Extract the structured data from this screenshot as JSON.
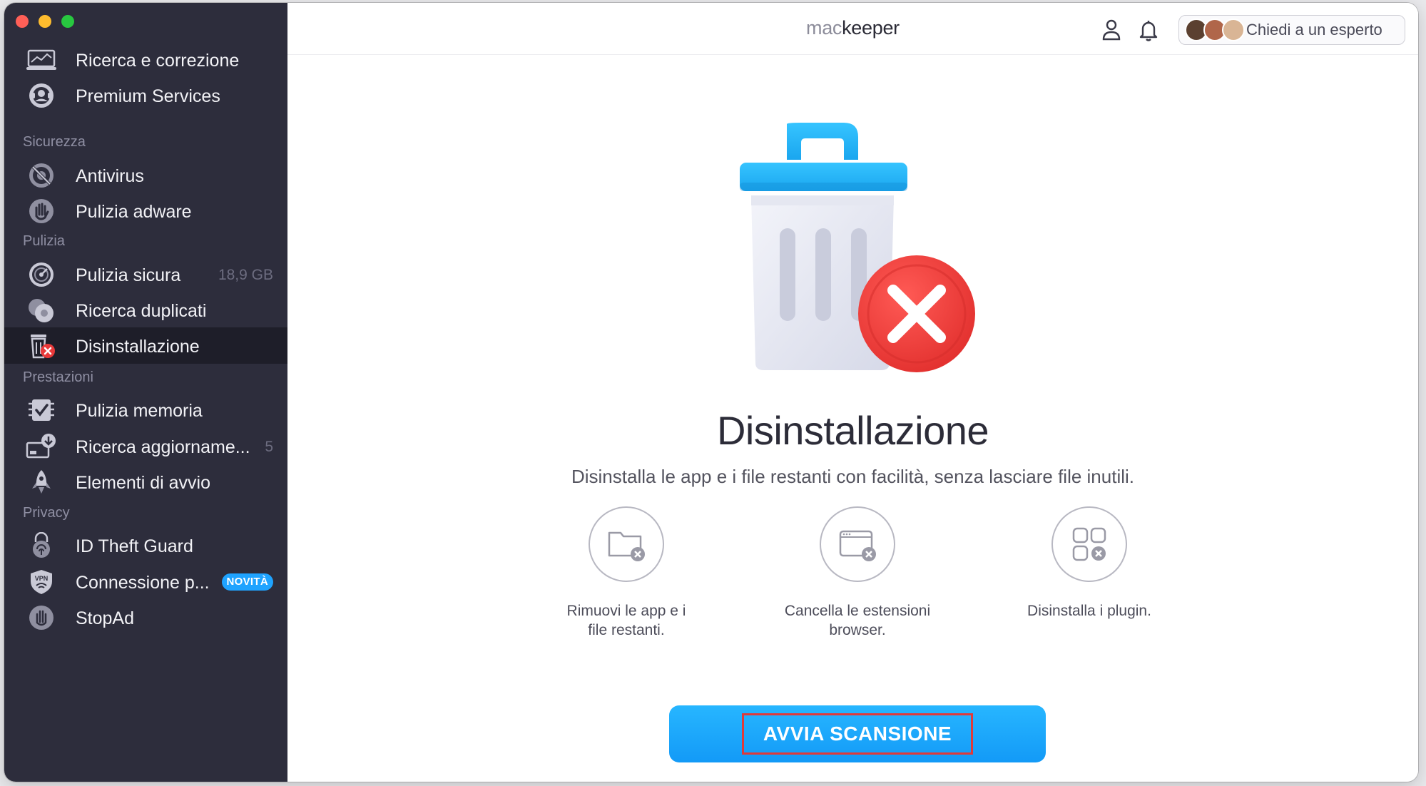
{
  "window": {
    "traffic_lights": [
      "close",
      "minimize",
      "maximize"
    ]
  },
  "sidebar": {
    "items": [
      {
        "label": "Ricerca e correzione",
        "icon": "laptop-chart-icon"
      },
      {
        "label": "Premium Services",
        "icon": "support-agent-icon"
      },
      {
        "label": "Antivirus",
        "icon": "antivirus-icon",
        "section": "Sicurezza"
      },
      {
        "label": "Pulizia adware",
        "icon": "hand-stop-icon"
      },
      {
        "label": "Pulizia sicura",
        "icon": "disk-cleaner-icon",
        "section": "Pulizia",
        "count": "18,9 GB"
      },
      {
        "label": "Ricerca duplicati",
        "icon": "duplicates-icon"
      },
      {
        "label": "Disinstallazione",
        "icon": "trash-uninstall-icon",
        "active": true
      },
      {
        "label": "Pulizia memoria",
        "icon": "memory-chip-icon",
        "section": "Prestazioni"
      },
      {
        "label": "Ricerca aggiorname...",
        "icon": "update-download-icon",
        "count": "5"
      },
      {
        "label": "Elementi di avvio",
        "icon": "rocket-icon"
      },
      {
        "label": "ID Theft Guard",
        "icon": "fingerprint-lock-icon",
        "section": "Privacy"
      },
      {
        "label": "Connessione p...",
        "icon": "vpn-shield-icon",
        "badge": "NOVITÀ"
      },
      {
        "label": "StopAd",
        "icon": "stopad-hand-icon"
      }
    ],
    "sections": [
      "Sicurezza",
      "Pulizia",
      "Prestazioni",
      "Privacy"
    ]
  },
  "header": {
    "logo_prefix": "mac",
    "logo_suffix": "keeper",
    "expert_button": "Chiedi a un esperto",
    "icons": [
      "profile-icon",
      "bell-icon"
    ]
  },
  "main": {
    "hero_icon": "trash-with-x-icon",
    "title": "Disinstallazione",
    "subtitle": "Disinstalla le app e i file restanti con facilità, senza lasciare file inutili.",
    "features": [
      {
        "line1": "Rimuovi le app e i",
        "line2": "file restanti.",
        "icon": "folder-remove-icon"
      },
      {
        "line1": "Cancella le estensioni",
        "line2": "browser.",
        "icon": "browser-remove-icon"
      },
      {
        "line1": "Disinstalla i plugin.",
        "line2": "",
        "icon": "plugins-remove-icon"
      }
    ],
    "scan_button": "AVVIA SCANSIONE"
  },
  "colors": {
    "sidebar_bg": "#2d2d3c",
    "sidebar_active_bg": "#1e1e29",
    "accent": "#1fa3ff",
    "badge": "#1fa3ff",
    "danger": "#e8393a",
    "highlight_border": "#e03a3a"
  }
}
